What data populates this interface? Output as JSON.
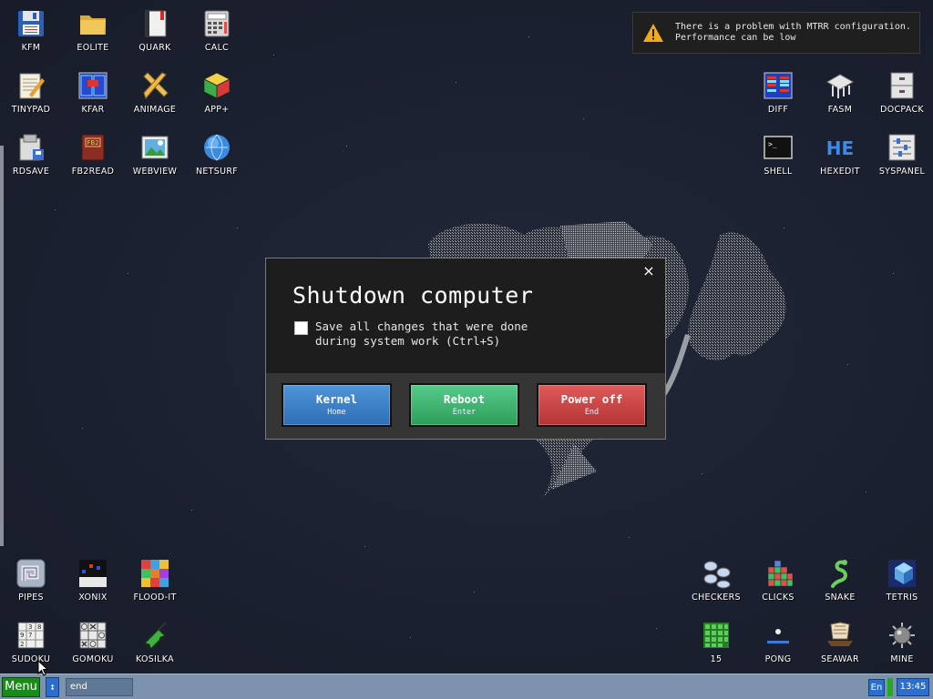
{
  "desktop": {
    "icons": {
      "kfm": "KFM",
      "eolite": "EOLITE",
      "quark": "QUARK",
      "calc": "CALC",
      "tinypad": "TINYPAD",
      "kfar": "KFAR",
      "animage": "ANIMAGE",
      "appplus": "APP+",
      "rdsave": "RDSAVE",
      "fb2read": "FB2READ",
      "webview": "WEBVIEW",
      "netsurf": "NETSURF",
      "diff": "DIFF",
      "fasm": "FASM",
      "docpack": "DOCPACK",
      "shell": "SHELL",
      "hexedit": "HEXEDIT",
      "syspanel": "SYSPANEL",
      "pipes": "PIPES",
      "xonix": "XONIX",
      "floodit": "FLOOD-IT",
      "sudoku": "SUDOKU",
      "gomoku": "GOMOKU",
      "kosilka": "KOSILKA",
      "checkers": "CHECKERS",
      "clicks": "CLICKS",
      "snake": "SNAKE",
      "tetris": "TETRIS",
      "fifteen": "15",
      "pong": "PONG",
      "seawar": "SEAWAR",
      "mine": "MINE"
    }
  },
  "notification": {
    "line1": "There is a problem with MTRR configuration.",
    "line2": "Performance can be low",
    "icon": "warning-icon",
    "color": "#f0a820"
  },
  "dialog": {
    "title": "Shutdown computer",
    "close": "×",
    "checkbox_line1": "Save all changes that were done",
    "checkbox_line2": "during system work (Ctrl+S)",
    "checkbox_checked": false,
    "buttons": {
      "kernel": {
        "label": "Kernel",
        "hint": "Home",
        "color": "#3f82c8"
      },
      "reboot": {
        "label": "Reboot",
        "hint": "Enter",
        "color": "#40b573"
      },
      "poweroff": {
        "label": "Power off",
        "hint": "End",
        "color": "#cc4444"
      }
    }
  },
  "taskbar": {
    "menu_label": "Menu",
    "swap_label": "↕",
    "task_field": "end",
    "language": "En",
    "clock": "13:45",
    "accent": "#7d93ad"
  }
}
